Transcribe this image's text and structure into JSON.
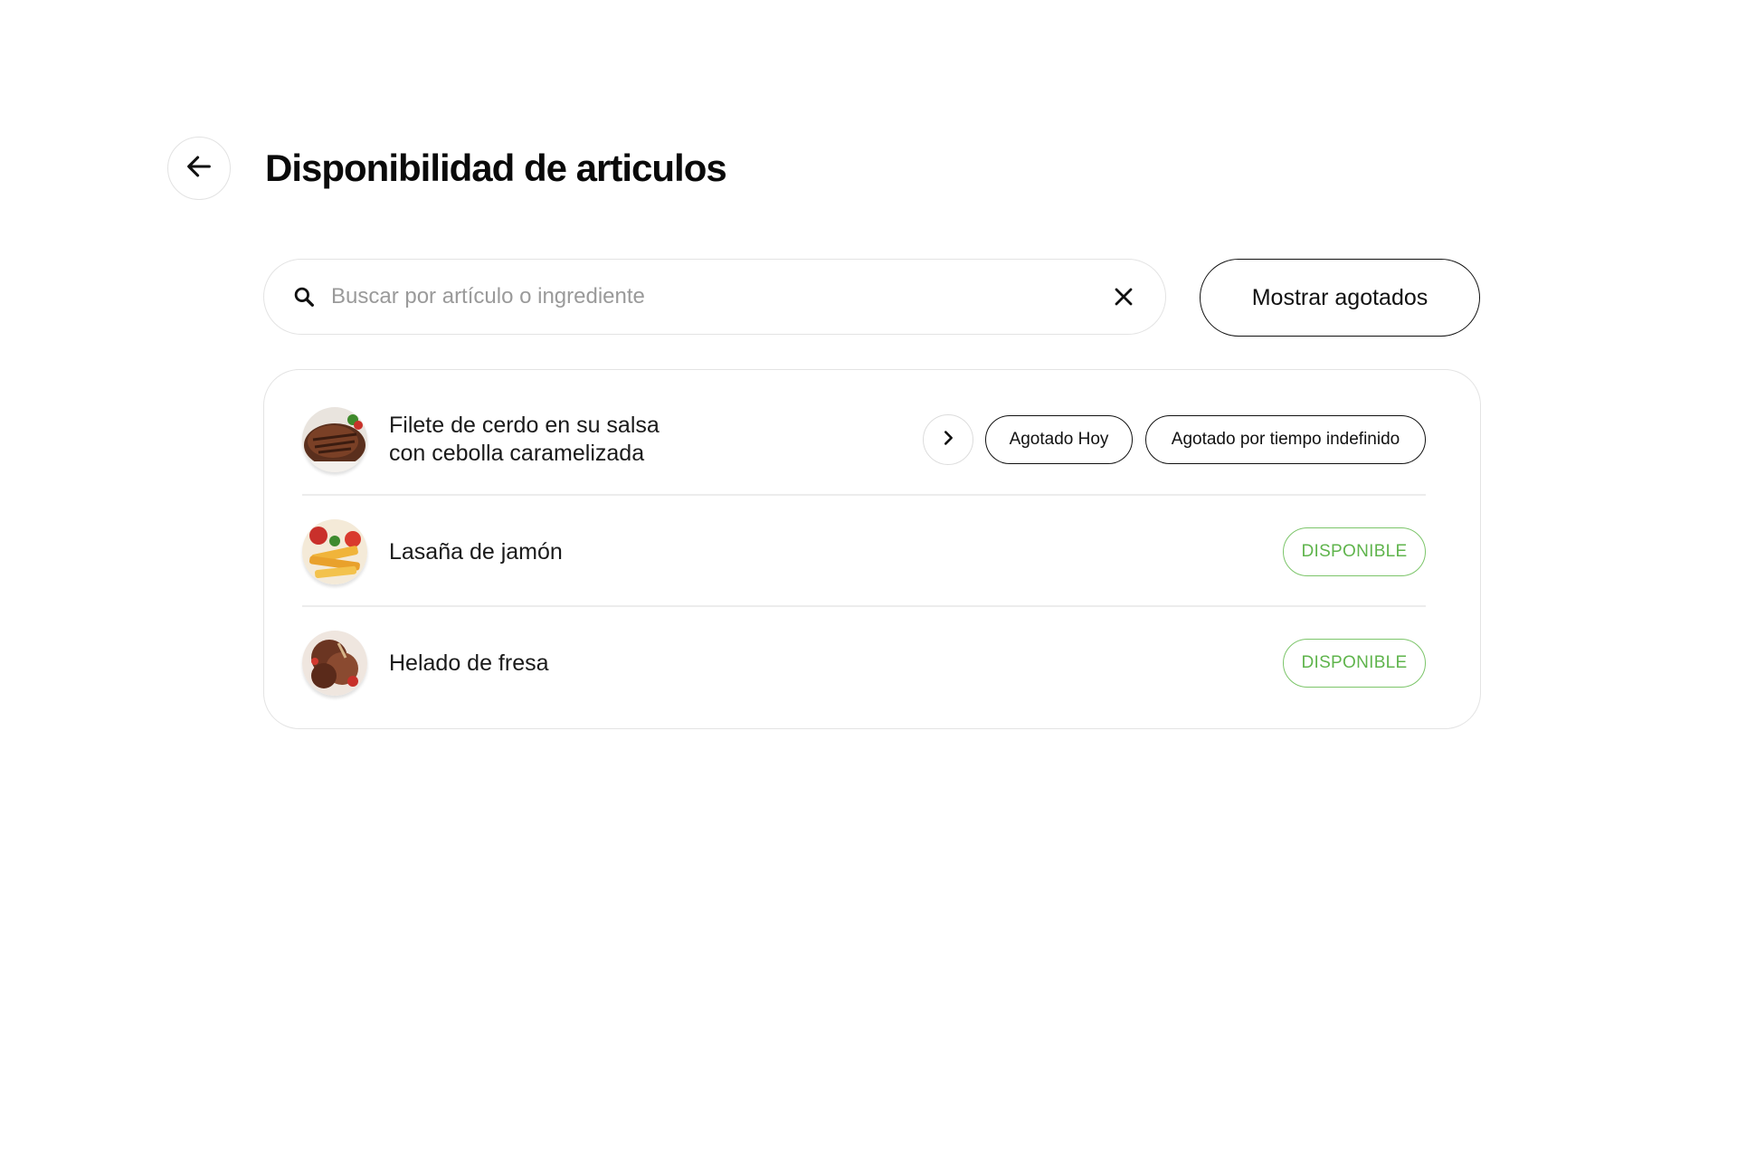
{
  "header": {
    "title": "Disponibilidad de articulos"
  },
  "search": {
    "placeholder": "Buscar por artículo o ingrediente",
    "value": ""
  },
  "toolbar": {
    "show_sold_out_label": "Mostrar agotados"
  },
  "items": [
    {
      "name_lines": [
        "Filete de cerdo en su salsa",
        "con cebolla caramelizada"
      ],
      "thumb": "steak",
      "actions": {
        "sold_out_today_label": "Agotado Hoy",
        "sold_out_indefinite_label": "Agotado por tiempo indefinido"
      }
    },
    {
      "name_lines": [
        "Lasaña de jamón"
      ],
      "thumb": "lasagna",
      "status_label": "DISPONIBLE"
    },
    {
      "name_lines": [
        "Helado de fresa"
      ],
      "thumb": "ice-cream",
      "status_label": "DISPONIBLE"
    }
  ],
  "colors": {
    "available": "#5fb44c",
    "border": "#e3e3e3",
    "text": "#111111"
  },
  "icons": {
    "back": "arrow-left-icon",
    "search": "magnifier-icon",
    "clear": "close-icon",
    "expand": "chevron-right-icon"
  }
}
